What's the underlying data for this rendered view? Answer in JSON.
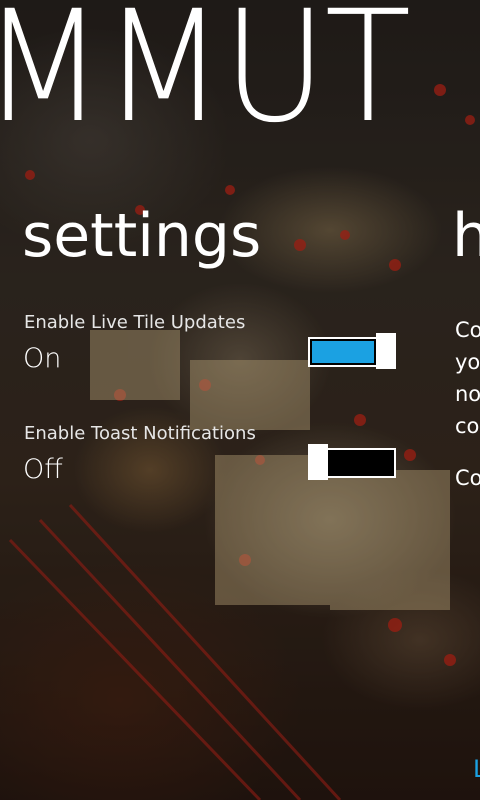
{
  "panorama": {
    "title": "MMUT"
  },
  "sections": {
    "settings_title": "settings",
    "next_title": "h"
  },
  "settings": {
    "live_tile": {
      "label": "Enable Live Tile Updates",
      "state": "On",
      "on": true
    },
    "toast": {
      "label": "Enable Toast Notifications",
      "state": "Off",
      "on": false
    }
  },
  "peek_panel": {
    "lines": [
      "Co",
      "yo",
      "no",
      "co"
    ],
    "second_paragraph": "Co",
    "link_glyph": "L"
  },
  "colors": {
    "accent": "#1ba1e2",
    "text": "#ffffff"
  }
}
